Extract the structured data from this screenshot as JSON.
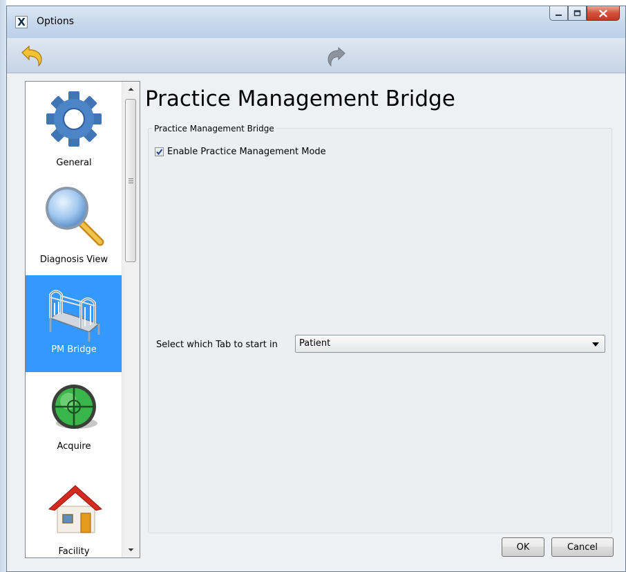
{
  "window": {
    "title": "Options",
    "app_icon_glyph": "X"
  },
  "toolbar": {
    "back_icon": "back-arrow-icon",
    "forward_icon": "forward-arrow-icon"
  },
  "sidebar": {
    "items": [
      {
        "label": "General",
        "icon": "gear-icon",
        "selected": false
      },
      {
        "label": "Diagnosis View",
        "icon": "magnifier-icon",
        "selected": false
      },
      {
        "label": "PM Bridge",
        "icon": "bridge-icon",
        "selected": true
      },
      {
        "label": "Acquire",
        "icon": "crosshair-disc-icon",
        "selected": false
      },
      {
        "label": "Facility",
        "icon": "house-icon",
        "selected": false
      }
    ]
  },
  "main": {
    "title": "Practice Management Bridge",
    "group_title": "Practice Management Bridge",
    "enable_checkbox": {
      "label": "Enable Practice Management Mode",
      "checked": true
    },
    "start_tab": {
      "label": "Select which Tab to start in",
      "value": "Patient"
    }
  },
  "buttons": {
    "ok": "OK",
    "cancel": "Cancel"
  },
  "colors": {
    "selection": "#3399ff",
    "close_button": "#c7432b",
    "toolbar": "#c5d4e6"
  }
}
